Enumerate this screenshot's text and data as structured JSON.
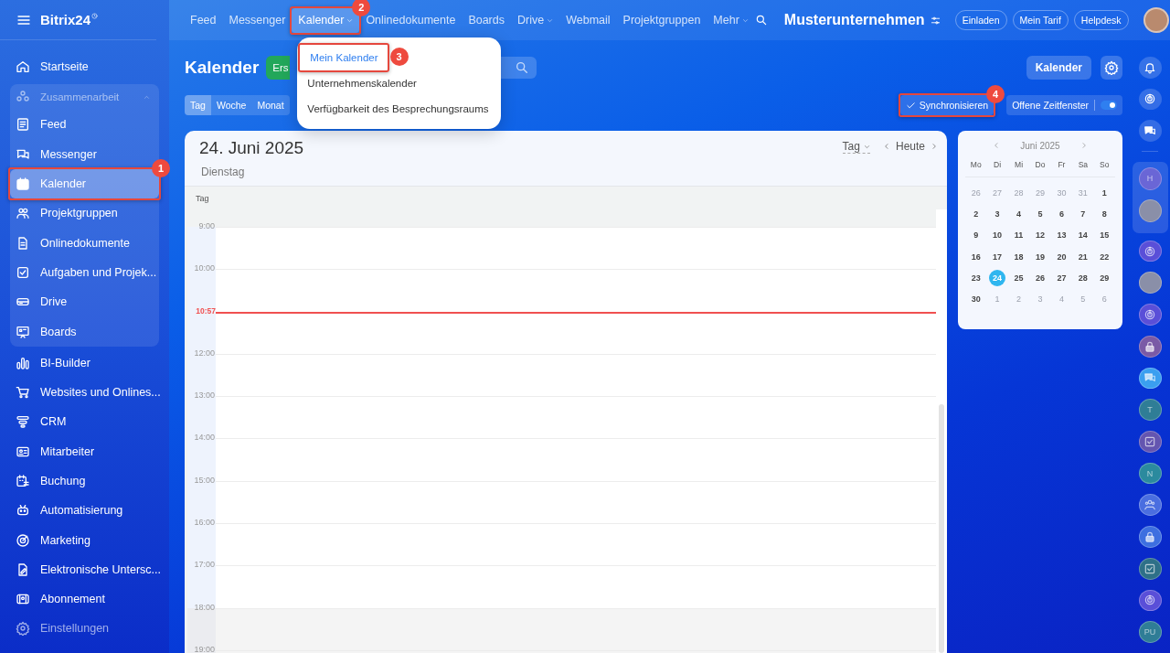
{
  "sidebar": {
    "logo": "Bitrix24",
    "items": [
      {
        "kind": "item",
        "label": "Startseite",
        "selected": false
      },
      {
        "kind": "group",
        "label": "Zusammenarbeit",
        "expanded": true,
        "children": [
          {
            "label": "Feed",
            "selected": false
          },
          {
            "label": "Messenger",
            "selected": false
          },
          {
            "label": "Kalender",
            "selected": true,
            "callout": "1"
          },
          {
            "label": "Projektgruppen",
            "selected": false
          },
          {
            "label": "Onlinedokumente",
            "selected": false
          },
          {
            "label": "Aufgaben und Projek...",
            "selected": false
          },
          {
            "label": "Drive",
            "selected": false
          },
          {
            "label": "Boards",
            "selected": false
          }
        ]
      },
      {
        "kind": "item",
        "label": "BI-Builder",
        "selected": false
      },
      {
        "kind": "item",
        "label": "Websites und Onlines...",
        "selected": false
      },
      {
        "kind": "item",
        "label": "CRM",
        "selected": false
      },
      {
        "kind": "item",
        "label": "Mitarbeiter",
        "selected": false
      },
      {
        "kind": "item",
        "label": "Buchung",
        "selected": false
      },
      {
        "kind": "item",
        "label": "Automatisierung",
        "selected": false
      },
      {
        "kind": "item",
        "label": "Marketing",
        "selected": false
      },
      {
        "kind": "item",
        "label": "Elektronische Untersc...",
        "selected": false
      },
      {
        "kind": "item",
        "label": "Abonnement",
        "selected": false
      },
      {
        "kind": "item",
        "label": "Einstellungen",
        "selected": false
      }
    ]
  },
  "topbar": {
    "nav": [
      {
        "label": "Feed",
        "dropdown": false,
        "selected": false
      },
      {
        "label": "Messenger",
        "dropdown": false,
        "selected": false
      },
      {
        "label": "Kalender",
        "dropdown": true,
        "selected": true,
        "callout": "2"
      },
      {
        "label": "Onlinedokumente",
        "dropdown": false,
        "selected": false
      },
      {
        "label": "Boards",
        "dropdown": false,
        "selected": false
      },
      {
        "label": "Drive",
        "dropdown": true,
        "selected": false
      },
      {
        "label": "Webmail",
        "dropdown": false,
        "selected": false
      },
      {
        "label": "Projektgruppen",
        "dropdown": false,
        "selected": false
      },
      {
        "label": "Mehr",
        "dropdown": true,
        "selected": false
      }
    ],
    "company": "Musterunternehmen",
    "buttons": [
      "Einladen",
      "Mein Tarif",
      "Helpdesk"
    ]
  },
  "menu": {
    "items": [
      {
        "label": "Mein Kalender",
        "selected": true,
        "callout": "3"
      },
      {
        "label": "Unternehmenskalender",
        "selected": false
      },
      {
        "label": "Verfügbarkeit des Besprechungsraums",
        "selected": false
      }
    ]
  },
  "page": {
    "title": "Kalender",
    "create_button": "Ers",
    "calendar_button": "Kalender",
    "view_tabs": [
      {
        "label": "Tag",
        "selected": true
      },
      {
        "label": "Woche",
        "selected": false
      },
      {
        "label": "Monat",
        "selected": false
      }
    ],
    "sync_button": {
      "label": "Synchronisieren",
      "callout": "4"
    },
    "slots_toggle": {
      "label": "Offene Zeitfenster",
      "on": true
    }
  },
  "calendar": {
    "date": "24. Juni 2025",
    "weekday": "Dienstag",
    "view": "Tag",
    "today": "Heute",
    "allday_label": "Tag",
    "rows": [
      {
        "kind": "hour",
        "label": "9:00",
        "off": false
      },
      {
        "kind": "hour",
        "label": "10:00",
        "off": false
      },
      {
        "kind": "now",
        "label": "10:57",
        "off": false
      },
      {
        "kind": "hour",
        "label": "12:00",
        "off": false
      },
      {
        "kind": "hour",
        "label": "13:00",
        "off": false
      },
      {
        "kind": "hour",
        "label": "14:00",
        "off": false
      },
      {
        "kind": "hour",
        "label": "15:00",
        "off": false
      },
      {
        "kind": "hour",
        "label": "16:00",
        "off": false
      },
      {
        "kind": "hour",
        "label": "17:00",
        "off": false
      },
      {
        "kind": "hour",
        "label": "18:00",
        "off": true
      },
      {
        "kind": "hour",
        "label": "19:00",
        "off": true
      }
    ]
  },
  "mini_calendar": {
    "month": "Juni 2025",
    "weekdays": [
      "Mo",
      "Di",
      "Mi",
      "Do",
      "Fr",
      "Sa",
      "So"
    ],
    "weeks": [
      [
        {
          "d": "26",
          "muted": true,
          "selected": false
        },
        {
          "d": "27",
          "muted": true,
          "selected": false
        },
        {
          "d": "28",
          "muted": true,
          "selected": false
        },
        {
          "d": "29",
          "muted": true,
          "selected": false
        },
        {
          "d": "30",
          "muted": true,
          "selected": false
        },
        {
          "d": "31",
          "muted": true,
          "selected": false
        },
        {
          "d": "1",
          "muted": false,
          "selected": false
        }
      ],
      [
        {
          "d": "2",
          "muted": false,
          "selected": false
        },
        {
          "d": "3",
          "muted": false,
          "selected": false
        },
        {
          "d": "4",
          "muted": false,
          "selected": false
        },
        {
          "d": "5",
          "muted": false,
          "selected": false
        },
        {
          "d": "6",
          "muted": false,
          "selected": false
        },
        {
          "d": "7",
          "muted": false,
          "selected": false
        },
        {
          "d": "8",
          "muted": false,
          "selected": false
        }
      ],
      [
        {
          "d": "9",
          "muted": false,
          "selected": false
        },
        {
          "d": "10",
          "muted": false,
          "selected": false
        },
        {
          "d": "11",
          "muted": false,
          "selected": false
        },
        {
          "d": "12",
          "muted": false,
          "selected": false
        },
        {
          "d": "13",
          "muted": false,
          "selected": false
        },
        {
          "d": "14",
          "muted": false,
          "selected": false
        },
        {
          "d": "15",
          "muted": false,
          "selected": false
        }
      ],
      [
        {
          "d": "16",
          "muted": false,
          "selected": false
        },
        {
          "d": "17",
          "muted": false,
          "selected": false
        },
        {
          "d": "18",
          "muted": false,
          "selected": false
        },
        {
          "d": "19",
          "muted": false,
          "selected": false
        },
        {
          "d": "20",
          "muted": false,
          "selected": false
        },
        {
          "d": "21",
          "muted": false,
          "selected": false
        },
        {
          "d": "22",
          "muted": false,
          "selected": false
        }
      ],
      [
        {
          "d": "23",
          "muted": false,
          "selected": false
        },
        {
          "d": "24",
          "muted": false,
          "selected": true
        },
        {
          "d": "25",
          "muted": false,
          "selected": false
        },
        {
          "d": "26",
          "muted": false,
          "selected": false
        },
        {
          "d": "27",
          "muted": false,
          "selected": false
        },
        {
          "d": "28",
          "muted": false,
          "selected": false
        },
        {
          "d": "29",
          "muted": false,
          "selected": false
        }
      ],
      [
        {
          "d": "30",
          "muted": false,
          "selected": false
        },
        {
          "d": "1",
          "muted": true,
          "selected": false
        },
        {
          "d": "2",
          "muted": true,
          "selected": false
        },
        {
          "d": "3",
          "muted": true,
          "selected": false
        },
        {
          "d": "4",
          "muted": true,
          "selected": false
        },
        {
          "d": "5",
          "muted": true,
          "selected": false
        },
        {
          "d": "6",
          "muted": true,
          "selected": false
        }
      ]
    ]
  },
  "rail": {
    "top": [
      {
        "kind": "bell"
      },
      {
        "kind": "spiral"
      },
      {
        "kind": "chat"
      }
    ],
    "group": [
      {
        "kind": "letter",
        "label": "H",
        "color": "#6a66d6"
      },
      {
        "kind": "avatar",
        "color": "#8a8fa8"
      }
    ],
    "items": [
      {
        "kind": "spiral",
        "color": "#5a4fd8"
      },
      {
        "kind": "avatar",
        "color": "#8a8fa8"
      },
      {
        "kind": "spiral",
        "color": "#5a4fd8"
      },
      {
        "kind": "lock",
        "color": "#7a5aa6"
      },
      {
        "kind": "chat",
        "color": "#3a9ff0"
      },
      {
        "kind": "letter",
        "label": "T",
        "color": "#2f7d96"
      },
      {
        "kind": "check",
        "color": "#6455b0"
      },
      {
        "kind": "letter",
        "label": "N",
        "color": "#2b8a9e"
      },
      {
        "kind": "people",
        "color": "#4a6ee0"
      },
      {
        "kind": "lock",
        "color": "#3d6fe0"
      },
      {
        "kind": "check",
        "color": "#2e7088"
      },
      {
        "kind": "spiral",
        "color": "#5a4fd8"
      },
      {
        "kind": "letter",
        "label": "PU",
        "color": "#2f7d96"
      }
    ]
  }
}
